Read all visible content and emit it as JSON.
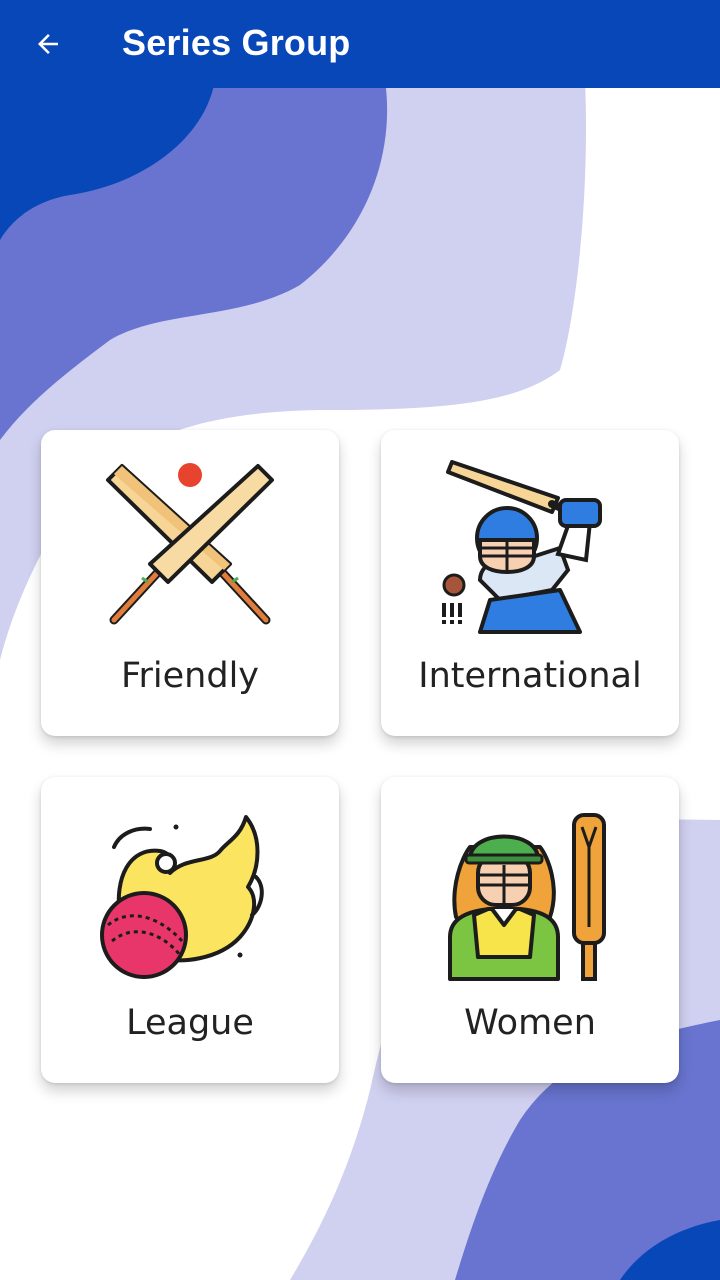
{
  "appbar": {
    "title": "Series Group",
    "back_icon": "arrow-left-icon",
    "color": "#0847b8"
  },
  "cards": [
    {
      "label": "Friendly",
      "icon": "crossed-cricket-bats-icon"
    },
    {
      "label": "International",
      "icon": "cricket-batsman-icon"
    },
    {
      "label": "League",
      "icon": "flaming-cricket-ball-icon"
    },
    {
      "label": "Women",
      "icon": "female-cricketer-icon"
    }
  ],
  "colors": {
    "wave_dark": "#6874cf",
    "wave_light": "#d0d0f0",
    "primary": "#0847b8"
  }
}
